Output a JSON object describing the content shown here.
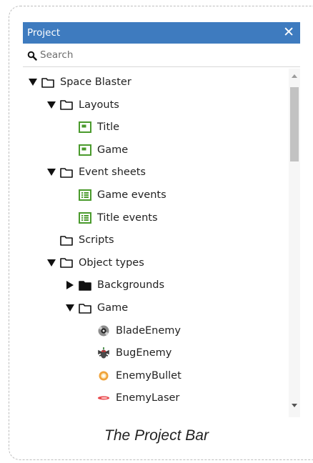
{
  "panel": {
    "title": "Project",
    "close_glyph": "✕"
  },
  "search": {
    "placeholder": "Search",
    "value": ""
  },
  "tree": [
    {
      "label": "Space Blaster",
      "icon": "folder-outline-icon",
      "level": 0,
      "expand": "expanded"
    },
    {
      "label": "Layouts",
      "icon": "folder-outline-icon",
      "level": 1,
      "expand": "expanded"
    },
    {
      "label": "Title",
      "icon": "layout-icon",
      "level": 2,
      "expand": "none"
    },
    {
      "label": "Game",
      "icon": "layout-icon",
      "level": 2,
      "expand": "none"
    },
    {
      "label": "Event sheets",
      "icon": "folder-outline-icon",
      "level": 1,
      "expand": "expanded"
    },
    {
      "label": "Game events",
      "icon": "event-sheet-icon",
      "level": 2,
      "expand": "none"
    },
    {
      "label": "Title events",
      "icon": "event-sheet-icon",
      "level": 2,
      "expand": "none"
    },
    {
      "label": "Scripts",
      "icon": "folder-outline-icon",
      "level": 1,
      "expand": "none"
    },
    {
      "label": "Object types",
      "icon": "folder-outline-icon",
      "level": 1,
      "expand": "expanded"
    },
    {
      "label": "Backgrounds",
      "icon": "folder-filled-icon",
      "level": 2,
      "expand": "collapsed"
    },
    {
      "label": "Game",
      "icon": "folder-outline-icon",
      "level": 2,
      "expand": "expanded"
    },
    {
      "label": "BladeEnemy",
      "icon": "blade-enemy-sprite-icon",
      "level": 3,
      "expand": "none"
    },
    {
      "label": "BugEnemy",
      "icon": "bug-enemy-sprite-icon",
      "level": 3,
      "expand": "none"
    },
    {
      "label": "EnemyBullet",
      "icon": "enemy-bullet-sprite-icon",
      "level": 3,
      "expand": "none"
    },
    {
      "label": "EnemyLaser",
      "icon": "enemy-laser-sprite-icon",
      "level": 3,
      "expand": "none"
    }
  ],
  "caption": "The Project Bar",
  "colors": {
    "titlebar": "#3e7bbf",
    "green_icon": "#4a9a2c",
    "thumb": "#c2c2c2"
  }
}
